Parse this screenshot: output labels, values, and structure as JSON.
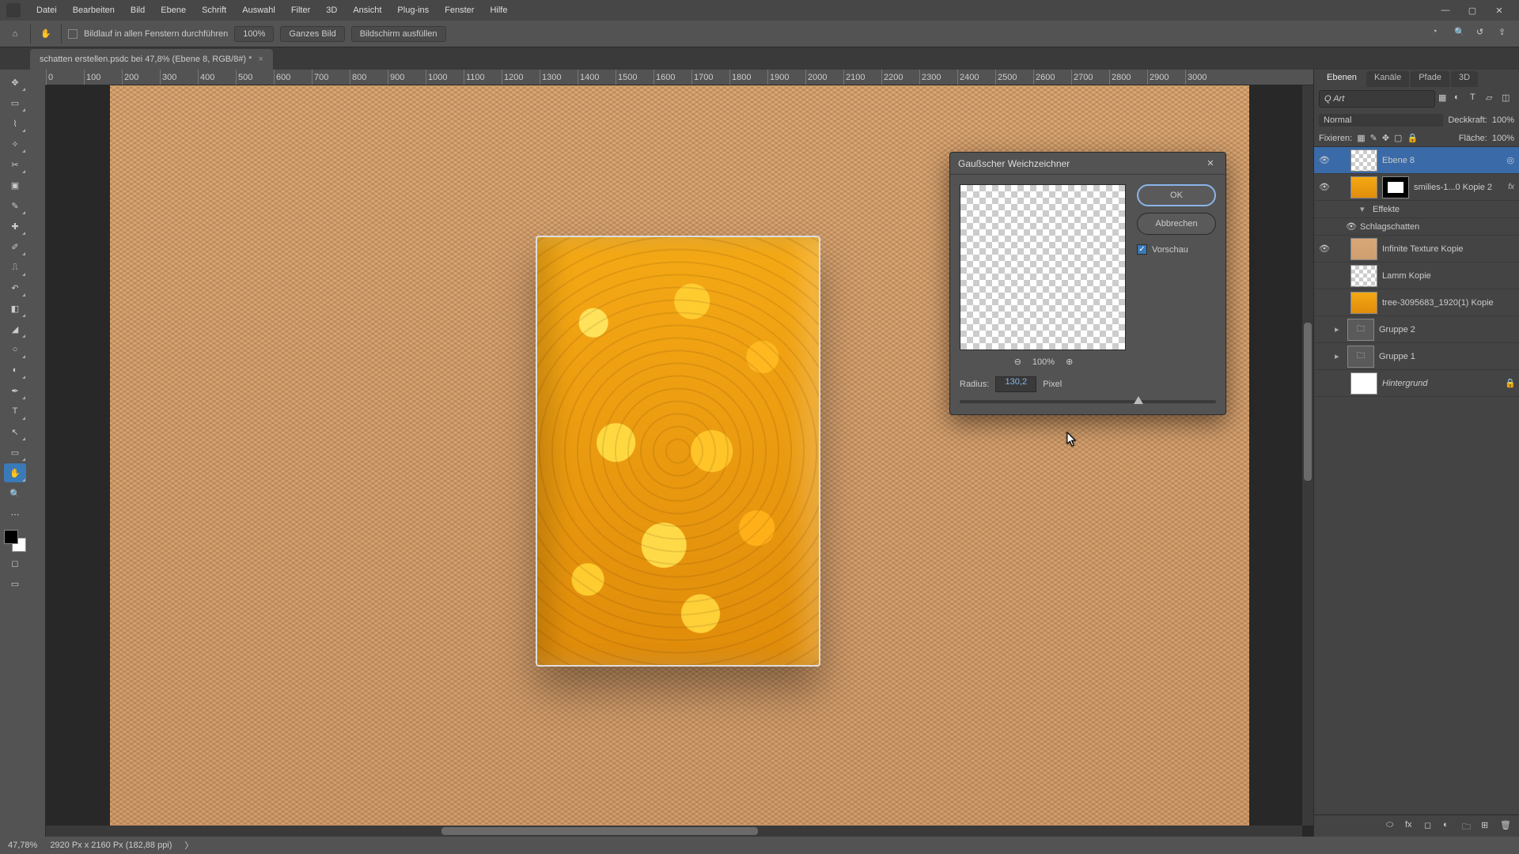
{
  "menu": [
    "Datei",
    "Bearbeiten",
    "Bild",
    "Ebene",
    "Schrift",
    "Auswahl",
    "Filter",
    "3D",
    "Ansicht",
    "Plug-ins",
    "Fenster",
    "Hilfe"
  ],
  "window_buttons": {
    "min": "—",
    "max": "▢",
    "close": "✕"
  },
  "options": {
    "scroll_all_label": "Bildlauf in allen Fenstern durchführen",
    "zoom_pct": "100%",
    "btn_whole": "Ganzes Bild",
    "btn_fill": "Bildschirm ausfüllen"
  },
  "tab": {
    "title": "schatten erstellen.psdc bei 47,8% (Ebene 8, RGB/8#) *",
    "close": "×"
  },
  "ruler_ticks": [
    "0",
    "100",
    "200",
    "300",
    "400",
    "500",
    "600",
    "700",
    "800",
    "900",
    "1000",
    "1100",
    "1200",
    "1300",
    "1400",
    "1500",
    "1600",
    "1700",
    "1800",
    "1900",
    "2000",
    "2100",
    "2200",
    "2300",
    "2400",
    "2500",
    "2600",
    "2700",
    "2800",
    "2900",
    "3000"
  ],
  "panels": {
    "tabs": [
      "Ebenen",
      "Kanäle",
      "Pfade",
      "3D"
    ],
    "search_placeholder": "Q Art",
    "blend_mode": "Normal",
    "opacity_label": "Deckkraft:",
    "opacity_value": "100%",
    "lock_label": "Fixieren:",
    "fill_label": "Fläche:",
    "fill_value": "100%",
    "layers": [
      {
        "name": "Ebene 8",
        "selected": true,
        "thumb": "checker",
        "eye": true
      },
      {
        "name": "smilies-1...0 Kopie 2",
        "thumb": "orange",
        "mask": true,
        "fx": "fx",
        "eye": true
      },
      {
        "name": "Effekte",
        "sub": true,
        "chev": "▾"
      },
      {
        "name": "Schlagschatten",
        "sub": true,
        "eye": true
      },
      {
        "name": "Infinite Texture Kopie",
        "thumb": "tex",
        "eye": true
      },
      {
        "name": "Lamm Kopie",
        "thumb": "checker"
      },
      {
        "name": "tree-3095683_1920(1) Kopie",
        "thumb": "orange"
      },
      {
        "name": "Gruppe 2",
        "thumb": "folder",
        "chev": "▸"
      },
      {
        "name": "Gruppe 1",
        "thumb": "folder",
        "chev": "▸"
      },
      {
        "name": "Hintergrund",
        "thumb": "white",
        "italic": true,
        "lock": true
      }
    ]
  },
  "dialog": {
    "title": "Gaußscher Weichzeichner",
    "ok": "OK",
    "cancel": "Abbrechen",
    "preview_label": "Vorschau",
    "zoom_out": "⊖",
    "zoom_pct": "100%",
    "zoom_in": "⊕",
    "radius_label": "Radius:",
    "radius_value": "130,2",
    "radius_unit": "Pixel",
    "close": "✕"
  },
  "status": {
    "zoom": "47,78%",
    "docinfo": "2920 Px x 2160 Px (182,88 ppi)",
    "arrow": "〉"
  }
}
